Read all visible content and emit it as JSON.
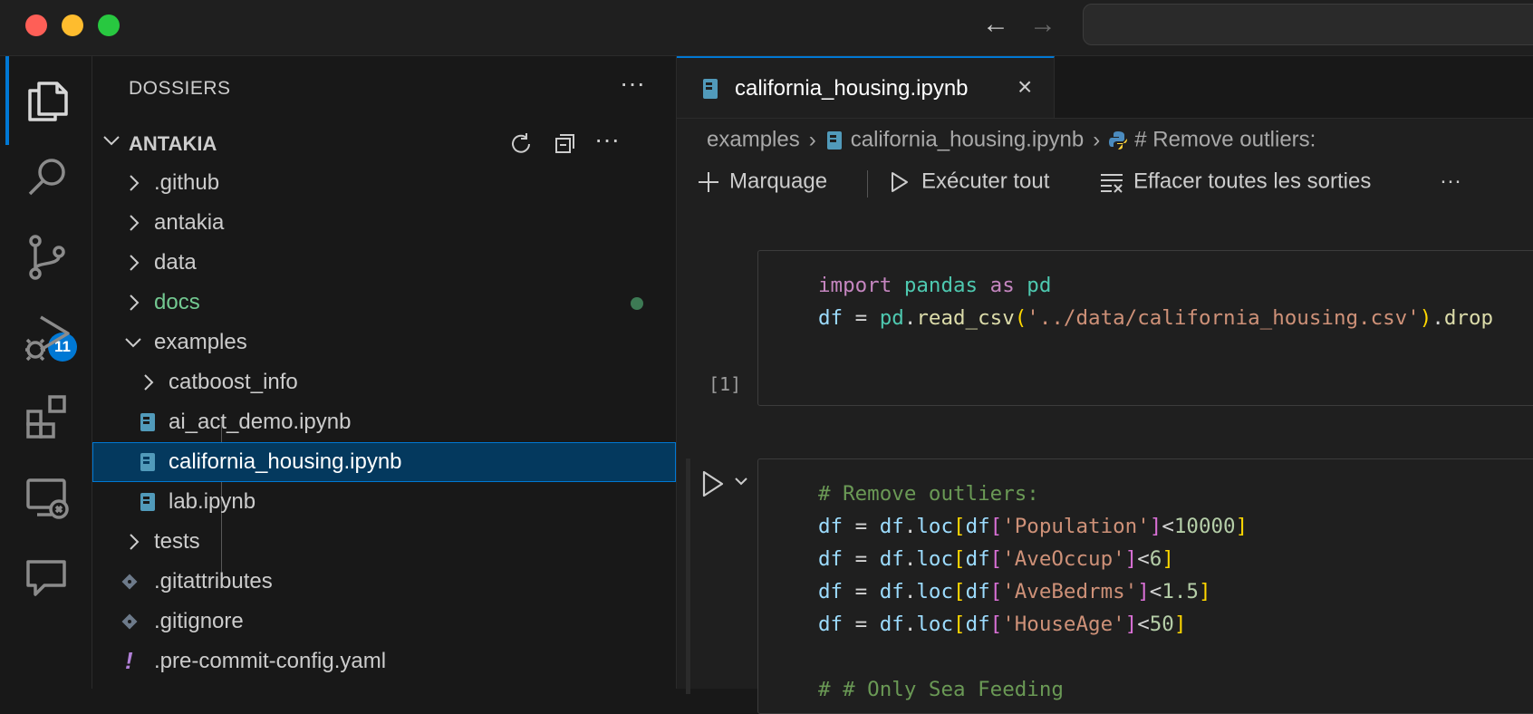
{
  "nav": {
    "back": "←",
    "forward": "→"
  },
  "activity_bar": {
    "source_control_badge": "11"
  },
  "sidebar": {
    "title": "DOSSIERS",
    "more": "···",
    "section": "ANTAKIA",
    "items": [
      {
        "label": ".github"
      },
      {
        "label": "antakia"
      },
      {
        "label": "data"
      },
      {
        "label": "docs"
      },
      {
        "label": "examples"
      },
      {
        "label": "catboost_info"
      },
      {
        "label": "ai_act_demo.ipynb"
      },
      {
        "label": "california_housing.ipynb"
      },
      {
        "label": "lab.ipynb"
      },
      {
        "label": "tests"
      },
      {
        "label": ".gitattributes"
      },
      {
        "label": ".gitignore"
      },
      {
        "label": ".pre-commit-config.yaml"
      }
    ]
  },
  "editor": {
    "tab_label": "california_housing.ipynb",
    "tab_close": "×",
    "breadcrumb": [
      "examples",
      "california_housing.ipynb",
      "# Remove outliers:"
    ],
    "toolbar": {
      "markdown": "Marquage",
      "run_all": "Exécuter tout",
      "clear_outputs": "Effacer toutes les sorties",
      "more": "···"
    },
    "cell1": {
      "exec_count": "[1]",
      "line1": {
        "t1": "import",
        "t2": "pandas",
        "t3": "as",
        "t4": "pd"
      },
      "line2": {
        "t1": "df",
        "t2": " = ",
        "t3": "pd",
        "t4": ".",
        "t5": "read_csv",
        "t6": "(",
        "t7": "'../data/california_housing.csv'",
        "t8": ")",
        "t9": ".",
        "t10": "drop"
      }
    },
    "cell2": {
      "comment": "# Remove outliers:",
      "lines": [
        {
          "col": "'Population'",
          "op": "<",
          "num": "10000"
        },
        {
          "col": "'AveOccup'",
          "op": "<",
          "num": "6"
        },
        {
          "col": "'AveBedrms'",
          "op": "<",
          "num": "1.5"
        },
        {
          "col": "'HouseAge'",
          "op": "<",
          "num": "50"
        }
      ],
      "partial_comment": "# # Only Sea Feeding"
    }
  },
  "colors": {
    "accent": "#0078d4",
    "selection": "#04395e",
    "modified": "#73c991"
  }
}
